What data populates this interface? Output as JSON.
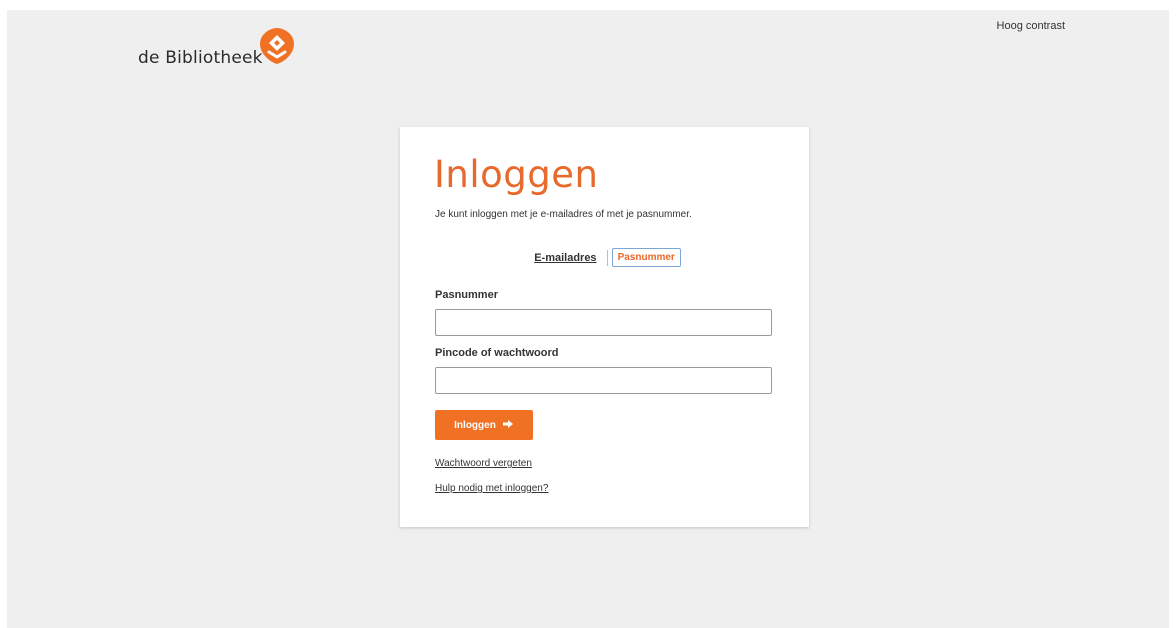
{
  "header": {
    "logo_text": "de Bibliotheek",
    "logo_icon": "bibliotheek-logo-icon",
    "high_contrast_label": "Hoog contrast"
  },
  "login_card": {
    "title": "Inloggen",
    "intro": "Je kunt inloggen met je e-mailadres of met je pasnummer.",
    "toggle": {
      "email_label": "E-mailadres",
      "pasnummer_label": "Pasnummer",
      "selected": "Pasnummer"
    },
    "fields": {
      "pasnummer_label": "Pasnummer",
      "pasnummer_value": "",
      "pincode_label": "Pincode of wachtwoord",
      "pincode_value": ""
    },
    "submit_label": "Inloggen",
    "submit_icon": "arrow-right-icon",
    "forgot_password_link": "Wachtwoord vergeten",
    "help_link": "Hulp nodig met inloggen?"
  },
  "colors": {
    "accent": "#f07124",
    "title": "#e8692c",
    "background": "#efefef",
    "card": "#ffffff"
  }
}
